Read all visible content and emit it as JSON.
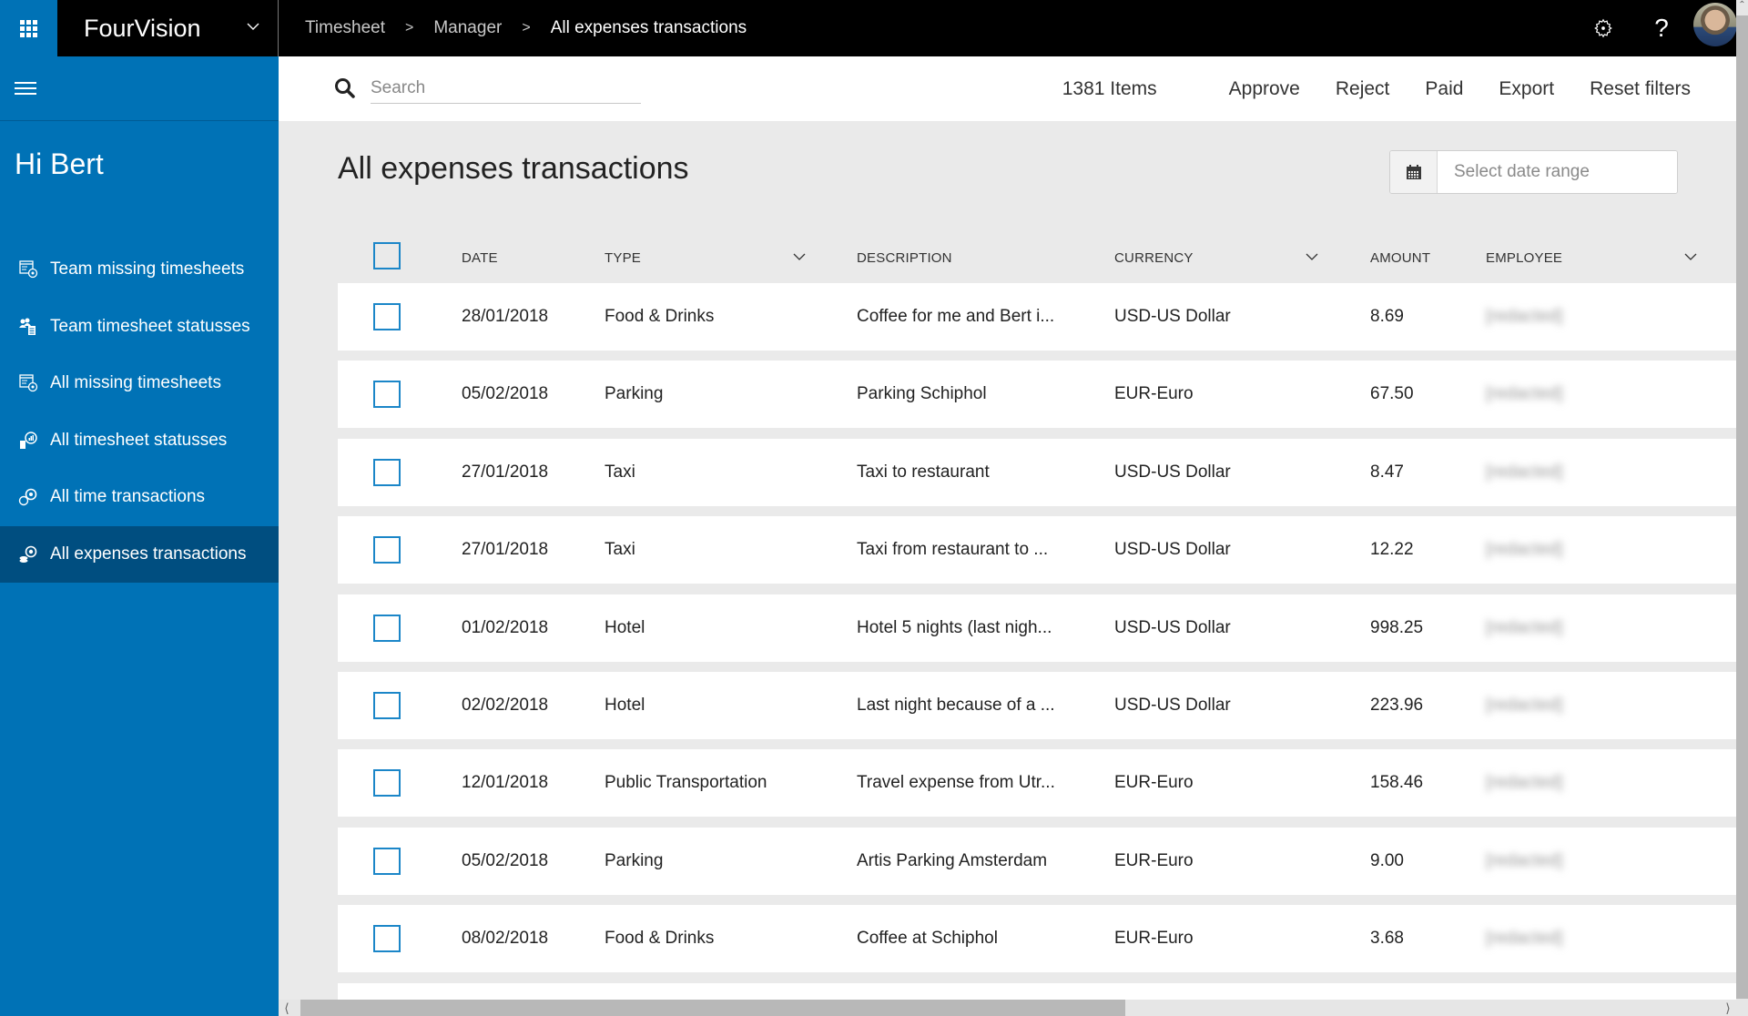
{
  "app": {
    "brand": "FourVision",
    "breadcrumb": [
      "Timesheet",
      "Manager",
      "All expenses transactions"
    ],
    "breadcrumb_separator": ">",
    "help_label": "?"
  },
  "sidebar": {
    "greeting": "Hi Bert",
    "items": [
      {
        "label": "Team missing timesheets",
        "icon": "calendar-clock-icon",
        "active": false
      },
      {
        "label": "Team timesheet statusses",
        "icon": "team-list-icon",
        "active": false
      },
      {
        "label": "All missing timesheets",
        "icon": "calendar-clock-icon",
        "active": false
      },
      {
        "label": "All timesheet statusses",
        "icon": "chart-doc-icon",
        "active": false
      },
      {
        "label": "All time transactions",
        "icon": "time-transaction-icon",
        "active": false
      },
      {
        "label": "All expenses transactions",
        "icon": "expense-transaction-icon",
        "active": true
      }
    ]
  },
  "toolbar": {
    "search_placeholder": "Search",
    "search_value": "",
    "item_count": "1381 Items",
    "actions": [
      "Approve",
      "Reject",
      "Paid",
      "Export",
      "Reset filters"
    ]
  },
  "page": {
    "title": "All expenses transactions",
    "date_range_placeholder": "Select date range"
  },
  "table": {
    "columns": [
      {
        "label": "DATE",
        "filter": false
      },
      {
        "label": "TYPE",
        "filter": true
      },
      {
        "label": "DESCRIPTION",
        "filter": false
      },
      {
        "label": "CURRENCY",
        "filter": true
      },
      {
        "label": "AMOUNT",
        "filter": false
      },
      {
        "label": "EMPLOYEE",
        "filter": true
      }
    ],
    "rows": [
      {
        "date": "28/01/2018",
        "type": "Food & Drinks",
        "description": "Coffee for me and Bert i...",
        "currency": "USD-US Dollar",
        "amount": "8.69",
        "employee": "[redacted]",
        "checked": false
      },
      {
        "date": "05/02/2018",
        "type": "Parking",
        "description": "Parking Schiphol",
        "currency": "EUR-Euro",
        "amount": "67.50",
        "employee": "[redacted]",
        "checked": false
      },
      {
        "date": "27/01/2018",
        "type": "Taxi",
        "description": "Taxi to restaurant",
        "currency": "USD-US Dollar",
        "amount": "8.47",
        "employee": "[redacted]",
        "checked": false
      },
      {
        "date": "27/01/2018",
        "type": "Taxi",
        "description": "Taxi from restaurant to ...",
        "currency": "USD-US Dollar",
        "amount": "12.22",
        "employee": "[redacted]",
        "checked": false
      },
      {
        "date": "01/02/2018",
        "type": "Hotel",
        "description": "Hotel 5 nights (last nigh...",
        "currency": "USD-US Dollar",
        "amount": "998.25",
        "employee": "[redacted]",
        "checked": false
      },
      {
        "date": "02/02/2018",
        "type": "Hotel",
        "description": "Last night because of a ...",
        "currency": "USD-US Dollar",
        "amount": "223.96",
        "employee": "[redacted]",
        "checked": false
      },
      {
        "date": "12/01/2018",
        "type": "Public Transportation",
        "description": "Travel expense from Utr...",
        "currency": "EUR-Euro",
        "amount": "158.46",
        "employee": "[redacted]",
        "checked": false
      },
      {
        "date": "05/02/2018",
        "type": "Parking",
        "description": "Artis Parking Amsterdam",
        "currency": "EUR-Euro",
        "amount": "9.00",
        "employee": "[redacted]",
        "checked": false
      },
      {
        "date": "08/02/2018",
        "type": "Food & Drinks",
        "description": "Coffee at Schiphol",
        "currency": "EUR-Euro",
        "amount": "3.68",
        "employee": "[redacted]",
        "checked": false
      }
    ]
  },
  "colors": {
    "sidebar": "#0072b6",
    "sidebar_active": "#004e80",
    "topbar": "#000000",
    "checkbox_border": "#1b86c8",
    "content_bg": "#eaeaea"
  }
}
